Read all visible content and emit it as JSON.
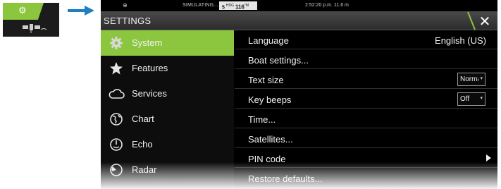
{
  "inset": {
    "gear_icon": "gear-icon",
    "satellite_icon": "satellite-icon",
    "accent": "#8cc63f"
  },
  "statusbar": {
    "globe_icon": "globe-icon",
    "mode": "SIMULATING...",
    "heading_prefix": "5",
    "heading_sup": "HDG",
    "heading_value": "116",
    "heading_unit": "°M",
    "time": "2:52:20 p.m.",
    "depth": "11.6 m"
  },
  "titlebar": {
    "title": "SETTINGS",
    "close_icon": "close-icon"
  },
  "nav": {
    "items": [
      {
        "label": "System",
        "icon": "gear-icon",
        "selected": true
      },
      {
        "label": "Features",
        "icon": "star-icon",
        "selected": false
      },
      {
        "label": "Services",
        "icon": "cloud-icon",
        "selected": false
      },
      {
        "label": "Chart",
        "icon": "globe-icon",
        "selected": false
      },
      {
        "label": "Echo",
        "icon": "echo-icon",
        "selected": false
      },
      {
        "label": "Radar",
        "icon": "radar-icon",
        "selected": false
      }
    ]
  },
  "settings": {
    "language_label": "Language",
    "language_value": "English (US)",
    "boat_label": "Boat settings...",
    "textsize_label": "Text size",
    "textsize_value": "Normal",
    "keybeeps_label": "Key beeps",
    "keybeeps_value": "Off",
    "time_label": "Time...",
    "satellites_label": "Satellites...",
    "pin_label": "PIN code",
    "restore_label": "Restore defaults..."
  },
  "colors": {
    "accent": "#8cc63f",
    "pointer_arrow": "#1f7fc1",
    "background": "#000000"
  }
}
